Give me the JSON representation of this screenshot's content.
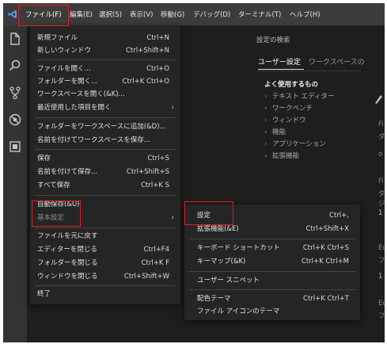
{
  "colors": {
    "menubar": "#3c3c3c",
    "activitybar": "#333333",
    "menu_bg": "#252526",
    "highlight": "#094771",
    "annotation_red": "#e02020",
    "accent": "#007acc"
  },
  "menubar": {
    "items": [
      "ファイル(F)",
      "編集(E)",
      "選択(S)",
      "表示(V)",
      "移動(G)",
      "デバッグ(D)",
      "ターミナル(T)",
      "ヘルプ(H)"
    ]
  },
  "activitybar": {
    "icons": [
      "files-icon",
      "search-icon",
      "source-control-icon",
      "debug-icon",
      "extensions-icon"
    ]
  },
  "settings": {
    "search_title": "設定の検索",
    "tab_user": "ユーザー設定",
    "tab_workspace": "ワークスペースの",
    "toc": [
      "よく使用するもの",
      "テキスト エディター",
      "ワークベンチ",
      "ウィンドウ",
      "機能",
      "アプリケーション",
      "拡張機能"
    ]
  },
  "file_menu": {
    "items": [
      {
        "label": "新規ファイル",
        "key": "Ctrl+N"
      },
      {
        "label": "新しいウィンドウ",
        "key": "Ctrl+Shift+N"
      },
      {
        "label": "ファイルを開く...",
        "key": "Ctrl+O"
      },
      {
        "label": "フォルダーを開く...",
        "key": "Ctrl+K Ctrl+O"
      },
      {
        "label": "ワークスペースを開く(&K)...",
        "key": ""
      },
      {
        "label": "最近使用した項目を開く",
        "key": ""
      },
      {
        "label": "フォルダーをワークスペースに追加(&D)...",
        "key": ""
      },
      {
        "label": "名前を付けてワークスペースを保存...",
        "key": ""
      },
      {
        "label": "保存",
        "key": "Ctrl+S"
      },
      {
        "label": "名前を付けて保存...",
        "key": "Ctrl+Shift+S"
      },
      {
        "label": "すべて保存",
        "key": "Ctrl+K S"
      },
      {
        "label": "自動保存(&U)",
        "key": ""
      },
      {
        "label": "基本設定",
        "key": ""
      },
      {
        "label": "ファイルを元に戻す",
        "key": ""
      },
      {
        "label": "エディターを閉じる",
        "key": "Ctrl+F4"
      },
      {
        "label": "フォルダーを閉じる",
        "key": "Ctrl+K F"
      },
      {
        "label": "ウィンドウを閉じる",
        "key": "Ctrl+Shift+W"
      },
      {
        "label": "終了",
        "key": ""
      }
    ],
    "submenu_arrow": "›"
  },
  "prefs_menu": {
    "items": [
      {
        "label": "設定",
        "key": "Ctrl+,"
      },
      {
        "label": "拡張機能(&E)",
        "key": "Ctrl+Shift+X"
      },
      {
        "label": "キーボード ショートカット",
        "key": "Ctrl+K Ctrl+S"
      },
      {
        "label": "キーマップ(&K)",
        "key": "Ctrl+K Ctrl+M"
      },
      {
        "label": "ユーザー スニペット",
        "key": ""
      },
      {
        "label": "配色テーマ",
        "key": "Ctrl+K Ctrl+T"
      },
      {
        "label": "ファイル アイコンのテーマ",
        "key": ""
      }
    ]
  },
  "edge": {
    "t1": "Fi",
    "t2": "ダ",
    "t3": "o",
    "t4": "Fi",
    "t5": "ダ",
    "t6": "ジ",
    "t7": "1",
    "t8": "Ec",
    "t9": "フ",
    "t10": "1",
    "t11": "Ec",
    "t12": "フ"
  }
}
